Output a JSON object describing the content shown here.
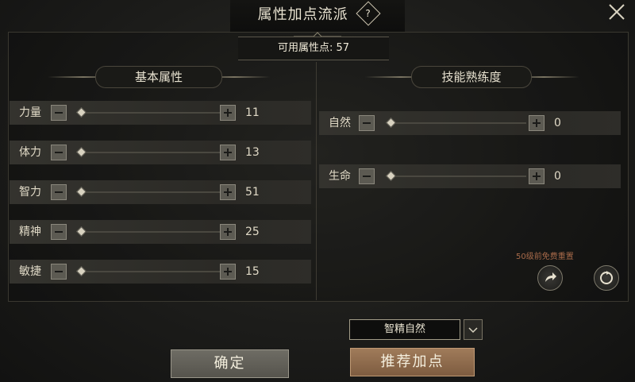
{
  "header": {
    "title": "属性加点流派",
    "help_glyph": "?"
  },
  "points": {
    "label": "可用属性点:",
    "value": "57"
  },
  "basic": {
    "title": "基本属性",
    "stats": [
      {
        "label": "力量",
        "value": "11"
      },
      {
        "label": "体力",
        "value": "13"
      },
      {
        "label": "智力",
        "value": "51"
      },
      {
        "label": "精神",
        "value": "25"
      },
      {
        "label": "敏捷",
        "value": "15"
      }
    ]
  },
  "skills": {
    "title": "技能熟练度",
    "stats": [
      {
        "label": "自然",
        "value": "0"
      },
      {
        "label": "生命",
        "value": "0"
      }
    ]
  },
  "reset_note": "50级前免费重置",
  "preset": {
    "value": "智精自然"
  },
  "buttons": {
    "confirm": "确定",
    "recommend": "推荐加点"
  },
  "icons": [
    "help-icon",
    "close-icon",
    "minus-icon",
    "plus-icon",
    "arrow-icon",
    "reset-icon",
    "chevron-down-icon"
  ],
  "colors": {
    "accent": "#a07b5a",
    "text": "#e0d9c6",
    "reset_note": "#a86a4a"
  }
}
